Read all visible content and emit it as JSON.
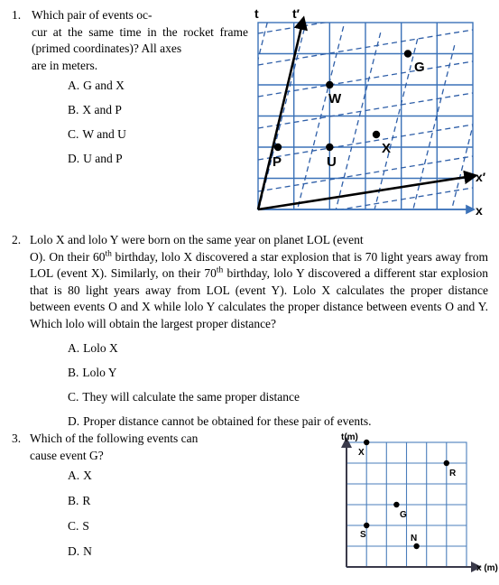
{
  "document": {
    "title": "Special relativity multiple choice questions"
  },
  "questions": [
    {
      "number": "1.",
      "text": "Which pair of events oc-",
      "text_line2": "cur at the same time in the rocket",
      "text_line3": "frame (primed coordinates)? All axes",
      "text_line4": "are in meters.",
      "choices": [
        {
          "label": "A.",
          "text": "G and X"
        },
        {
          "label": "B.",
          "text": "X and P"
        },
        {
          "label": "C.",
          "text": "W and U"
        },
        {
          "label": "D.",
          "text": "U and P"
        }
      ]
    },
    {
      "number": "2.",
      "line1": "Lolo X and lolo Y were born on the same year on planet LOL (event",
      "body_part1": "O). On their 60",
      "sup1": "th",
      "body_part2": " birthday, lolo X discovered a star explosion that is 70 light years away from LOL (event X). Similarly, on their 70",
      "sup2": "th",
      "body_part3": " birthday, lolo Y discovered a different star explosion that is 80 light years away from LOL (event Y). Lolo X calculates the proper distance between events O and X while lolo Y calculates the proper distance between events O and Y. Which lolo will obtain the largest proper distance?",
      "choices": [
        {
          "label": "A.",
          "text": "Lolo X"
        },
        {
          "label": "B.",
          "text": "Lolo Y"
        },
        {
          "label": "C.",
          "text": "They will calculate the same proper distance"
        },
        {
          "label": "D.",
          "text": "Proper distance cannot be obtained for these pair of events."
        }
      ]
    },
    {
      "number": "3.",
      "text_line1": "Which of the following events can",
      "text_line2": "cause event G?",
      "choices": [
        {
          "label": "A.",
          "text": "X"
        },
        {
          "label": "B.",
          "text": "R"
        },
        {
          "label": "C.",
          "text": "S"
        },
        {
          "label": "D.",
          "text": "N"
        }
      ]
    }
  ],
  "figure1": {
    "name": "minkowski-spacetime-diagram",
    "axis_labels": {
      "t": "t",
      "t_prime": "t′",
      "x": "x",
      "x_prime": "x′"
    },
    "events": [
      {
        "label": "G",
        "lab_x": 4.0,
        "lab_t": 4.6
      },
      {
        "label": "W",
        "lab_x": 2.0,
        "lab_t": 3.0
      },
      {
        "label": "X",
        "lab_x": 3.5,
        "lab_t": 1.85
      },
      {
        "label": "P",
        "lab_x": 0.5,
        "lab_t": 1.25
      },
      {
        "label": "U",
        "lab_x": 2.0,
        "lab_t": 1.2
      }
    ],
    "grid": {
      "cols": 6,
      "rows": 6,
      "color": "#3b72b8"
    },
    "primed_grid": {
      "color": "#2f5fa8",
      "style": "dashed"
    },
    "axes_color": "#000000"
  },
  "figure2": {
    "name": "spacetime-grid-diagram",
    "axis_labels": {
      "t": "t(m)",
      "x": "x (m)"
    },
    "events": [
      {
        "label": "X",
        "x": 1,
        "t": 6
      },
      {
        "label": "R",
        "x": 4,
        "t": 5
      },
      {
        "label": "G",
        "x": 2.5,
        "t": 3
      },
      {
        "label": "S",
        "x": 1,
        "t": 2
      },
      {
        "label": "N",
        "x": 3,
        "t": 1
      }
    ],
    "grid": {
      "cols": 6,
      "rows": 6,
      "color": "#4a7ebb"
    },
    "axes_color": "#3a3a4a"
  }
}
